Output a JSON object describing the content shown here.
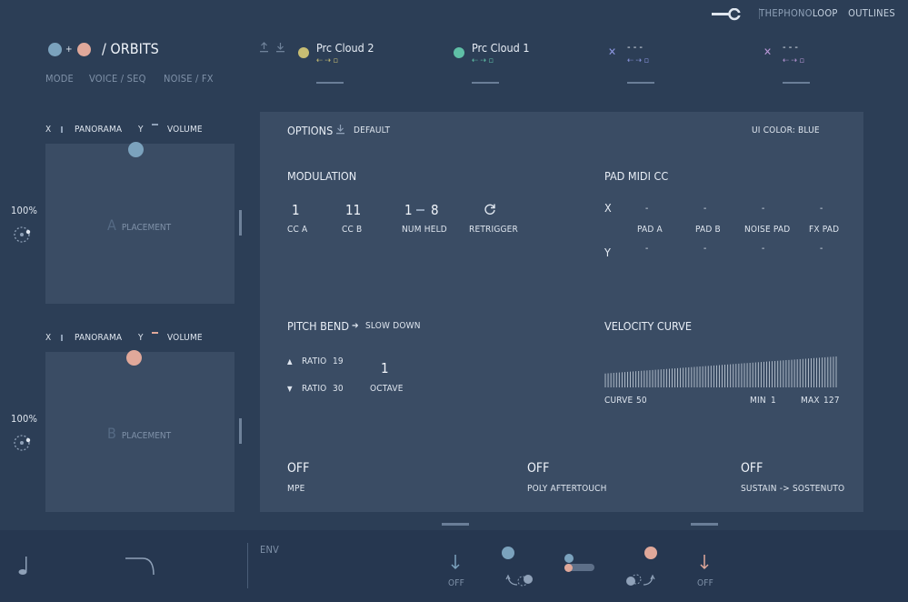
{
  "brand": {
    "part1": "THEPHONO",
    "part2": "LOOP",
    "outlines": "OUTLINES"
  },
  "header": {
    "title": "/ ORBITS",
    "plus": "+",
    "nav": [
      "MODE",
      "VOICE / SEQ",
      "NOISE / FX"
    ]
  },
  "slots": [
    {
      "name": "Prc Cloud 2",
      "color": "#c7bd73",
      "arrow_color": "#c7bd73"
    },
    {
      "name": "Prc Cloud 1",
      "color": "#5fbfa6",
      "arrow_color": "#5fbfa6"
    },
    {
      "name": "- - -",
      "color": "#8c96e0",
      "arrow_color": "#8c96e0"
    },
    {
      "name": "- - -",
      "color": "#b896d6",
      "arrow_color": "#b896d6"
    }
  ],
  "pads": [
    {
      "x_label": "X",
      "x_value_label": "PANORAMA",
      "y_label": "Y",
      "y_value_label": "VOLUME",
      "letter": "A",
      "placement": "PLACEMENT",
      "percent": "100%",
      "dot_color": "#7ba2bd"
    },
    {
      "x_label": "X",
      "x_value_label": "PANORAMA",
      "y_label": "Y",
      "y_value_label": "VOLUME",
      "letter": "B",
      "placement": "PLACEMENT",
      "percent": "100%",
      "dot_color": "#e0a89a"
    }
  ],
  "options": {
    "title": "OPTIONS",
    "preset": "DEFAULT",
    "ui_color": "UI COLOR: BLUE"
  },
  "modulation": {
    "title": "MODULATION",
    "cc_a": {
      "value": "1",
      "label": "CC A"
    },
    "cc_b": {
      "value": "11",
      "label": "CC B"
    },
    "num_held": {
      "from": "1",
      "to": "8",
      "label": "NUM HELD"
    },
    "retrigger": {
      "label": "RETRIGGER"
    }
  },
  "pad_midi_cc": {
    "title": "PAD MIDI CC",
    "x": "X",
    "y": "Y",
    "columns": [
      "PAD A",
      "PAD B",
      "NOISE PAD",
      "FX PAD"
    ],
    "x_values": [
      "-",
      "-",
      "-",
      "-"
    ],
    "y_values": [
      "-",
      "-",
      "-",
      "-"
    ]
  },
  "pitch_bend": {
    "title": "PITCH BEND",
    "mode": "SLOW DOWN",
    "ratio_up": {
      "label": "RATIO",
      "value": "19"
    },
    "ratio_down": {
      "label": "RATIO",
      "value": "30"
    },
    "octave": {
      "value": "1",
      "label": "OCTAVE"
    }
  },
  "velocity_curve": {
    "title": "VELOCITY CURVE",
    "curve_label": "CURVE",
    "curve_value": "50",
    "min_label": "MIN",
    "min_value": "1",
    "max_label": "MAX",
    "max_value": "127"
  },
  "toggles": [
    {
      "value": "OFF",
      "label": "MPE"
    },
    {
      "value": "OFF",
      "label": "POLY AFTERTOUCH"
    },
    {
      "value": "OFF",
      "label": "SUSTAIN -> SOSTENUTO"
    }
  ],
  "footer": {
    "env": "ENV",
    "left_off": "OFF",
    "right_off": "OFF"
  },
  "colors": {
    "bg": "#2c3e56",
    "panel": "#3a4c64",
    "footer": "#263750",
    "blue": "#7ba2bd",
    "pink": "#e0a89a"
  }
}
